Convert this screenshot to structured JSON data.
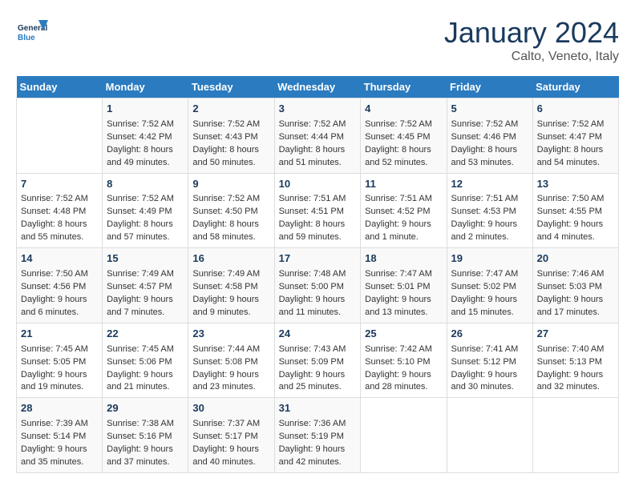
{
  "header": {
    "logo_general": "General",
    "logo_blue": "Blue",
    "month_year": "January 2024",
    "location": "Calto, Veneto, Italy"
  },
  "days_of_week": [
    "Sunday",
    "Monday",
    "Tuesday",
    "Wednesday",
    "Thursday",
    "Friday",
    "Saturday"
  ],
  "weeks": [
    [
      {
        "day": "",
        "sunrise": "",
        "sunset": "",
        "daylight": ""
      },
      {
        "day": "1",
        "sunrise": "Sunrise: 7:52 AM",
        "sunset": "Sunset: 4:42 PM",
        "daylight": "Daylight: 8 hours and 49 minutes."
      },
      {
        "day": "2",
        "sunrise": "Sunrise: 7:52 AM",
        "sunset": "Sunset: 4:43 PM",
        "daylight": "Daylight: 8 hours and 50 minutes."
      },
      {
        "day": "3",
        "sunrise": "Sunrise: 7:52 AM",
        "sunset": "Sunset: 4:44 PM",
        "daylight": "Daylight: 8 hours and 51 minutes."
      },
      {
        "day": "4",
        "sunrise": "Sunrise: 7:52 AM",
        "sunset": "Sunset: 4:45 PM",
        "daylight": "Daylight: 8 hours and 52 minutes."
      },
      {
        "day": "5",
        "sunrise": "Sunrise: 7:52 AM",
        "sunset": "Sunset: 4:46 PM",
        "daylight": "Daylight: 8 hours and 53 minutes."
      },
      {
        "day": "6",
        "sunrise": "Sunrise: 7:52 AM",
        "sunset": "Sunset: 4:47 PM",
        "daylight": "Daylight: 8 hours and 54 minutes."
      }
    ],
    [
      {
        "day": "7",
        "sunrise": "Sunrise: 7:52 AM",
        "sunset": "Sunset: 4:48 PM",
        "daylight": "Daylight: 8 hours and 55 minutes."
      },
      {
        "day": "8",
        "sunrise": "Sunrise: 7:52 AM",
        "sunset": "Sunset: 4:49 PM",
        "daylight": "Daylight: 8 hours and 57 minutes."
      },
      {
        "day": "9",
        "sunrise": "Sunrise: 7:52 AM",
        "sunset": "Sunset: 4:50 PM",
        "daylight": "Daylight: 8 hours and 58 minutes."
      },
      {
        "day": "10",
        "sunrise": "Sunrise: 7:51 AM",
        "sunset": "Sunset: 4:51 PM",
        "daylight": "Daylight: 8 hours and 59 minutes."
      },
      {
        "day": "11",
        "sunrise": "Sunrise: 7:51 AM",
        "sunset": "Sunset: 4:52 PM",
        "daylight": "Daylight: 9 hours and 1 minute."
      },
      {
        "day": "12",
        "sunrise": "Sunrise: 7:51 AM",
        "sunset": "Sunset: 4:53 PM",
        "daylight": "Daylight: 9 hours and 2 minutes."
      },
      {
        "day": "13",
        "sunrise": "Sunrise: 7:50 AM",
        "sunset": "Sunset: 4:55 PM",
        "daylight": "Daylight: 9 hours and 4 minutes."
      }
    ],
    [
      {
        "day": "14",
        "sunrise": "Sunrise: 7:50 AM",
        "sunset": "Sunset: 4:56 PM",
        "daylight": "Daylight: 9 hours and 6 minutes."
      },
      {
        "day": "15",
        "sunrise": "Sunrise: 7:49 AM",
        "sunset": "Sunset: 4:57 PM",
        "daylight": "Daylight: 9 hours and 7 minutes."
      },
      {
        "day": "16",
        "sunrise": "Sunrise: 7:49 AM",
        "sunset": "Sunset: 4:58 PM",
        "daylight": "Daylight: 9 hours and 9 minutes."
      },
      {
        "day": "17",
        "sunrise": "Sunrise: 7:48 AM",
        "sunset": "Sunset: 5:00 PM",
        "daylight": "Daylight: 9 hours and 11 minutes."
      },
      {
        "day": "18",
        "sunrise": "Sunrise: 7:47 AM",
        "sunset": "Sunset: 5:01 PM",
        "daylight": "Daylight: 9 hours and 13 minutes."
      },
      {
        "day": "19",
        "sunrise": "Sunrise: 7:47 AM",
        "sunset": "Sunset: 5:02 PM",
        "daylight": "Daylight: 9 hours and 15 minutes."
      },
      {
        "day": "20",
        "sunrise": "Sunrise: 7:46 AM",
        "sunset": "Sunset: 5:03 PM",
        "daylight": "Daylight: 9 hours and 17 minutes."
      }
    ],
    [
      {
        "day": "21",
        "sunrise": "Sunrise: 7:45 AM",
        "sunset": "Sunset: 5:05 PM",
        "daylight": "Daylight: 9 hours and 19 minutes."
      },
      {
        "day": "22",
        "sunrise": "Sunrise: 7:45 AM",
        "sunset": "Sunset: 5:06 PM",
        "daylight": "Daylight: 9 hours and 21 minutes."
      },
      {
        "day": "23",
        "sunrise": "Sunrise: 7:44 AM",
        "sunset": "Sunset: 5:08 PM",
        "daylight": "Daylight: 9 hours and 23 minutes."
      },
      {
        "day": "24",
        "sunrise": "Sunrise: 7:43 AM",
        "sunset": "Sunset: 5:09 PM",
        "daylight": "Daylight: 9 hours and 25 minutes."
      },
      {
        "day": "25",
        "sunrise": "Sunrise: 7:42 AM",
        "sunset": "Sunset: 5:10 PM",
        "daylight": "Daylight: 9 hours and 28 minutes."
      },
      {
        "day": "26",
        "sunrise": "Sunrise: 7:41 AM",
        "sunset": "Sunset: 5:12 PM",
        "daylight": "Daylight: 9 hours and 30 minutes."
      },
      {
        "day": "27",
        "sunrise": "Sunrise: 7:40 AM",
        "sunset": "Sunset: 5:13 PM",
        "daylight": "Daylight: 9 hours and 32 minutes."
      }
    ],
    [
      {
        "day": "28",
        "sunrise": "Sunrise: 7:39 AM",
        "sunset": "Sunset: 5:14 PM",
        "daylight": "Daylight: 9 hours and 35 minutes."
      },
      {
        "day": "29",
        "sunrise": "Sunrise: 7:38 AM",
        "sunset": "Sunset: 5:16 PM",
        "daylight": "Daylight: 9 hours and 37 minutes."
      },
      {
        "day": "30",
        "sunrise": "Sunrise: 7:37 AM",
        "sunset": "Sunset: 5:17 PM",
        "daylight": "Daylight: 9 hours and 40 minutes."
      },
      {
        "day": "31",
        "sunrise": "Sunrise: 7:36 AM",
        "sunset": "Sunset: 5:19 PM",
        "daylight": "Daylight: 9 hours and 42 minutes."
      },
      {
        "day": "",
        "sunrise": "",
        "sunset": "",
        "daylight": ""
      },
      {
        "day": "",
        "sunrise": "",
        "sunset": "",
        "daylight": ""
      },
      {
        "day": "",
        "sunrise": "",
        "sunset": "",
        "daylight": ""
      }
    ]
  ]
}
